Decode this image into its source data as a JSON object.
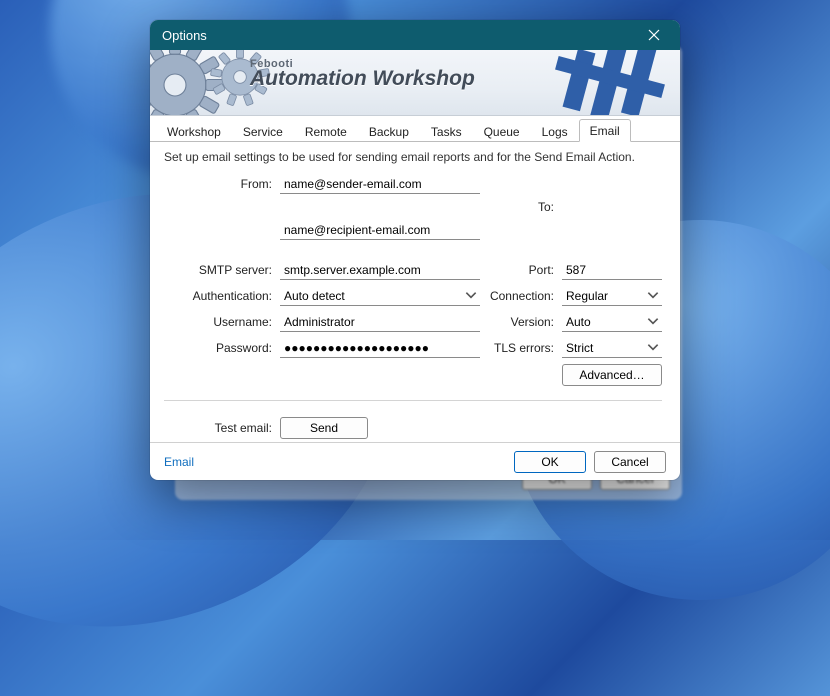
{
  "window": {
    "title": "Options"
  },
  "banner": {
    "brand_small": "Febooti",
    "brand_main": "Automation Workshop"
  },
  "tabs": {
    "items": [
      "Workshop",
      "Service",
      "Remote",
      "Backup",
      "Tasks",
      "Queue",
      "Logs",
      "Email"
    ],
    "active_index": 7
  },
  "page": {
    "description": "Set up email settings to be used for sending email reports and for the Send Email Action."
  },
  "labels": {
    "from": "From:",
    "to": "To:",
    "smtp": "SMTP server:",
    "auth": "Authentication:",
    "user": "Username:",
    "pass": "Password:",
    "port": "Port:",
    "connection": "Connection:",
    "version": "Version:",
    "tls": "TLS errors:",
    "test": "Test email:"
  },
  "values": {
    "from": "name@sender-email.com",
    "to": "name@recipient-email.com",
    "smtp": "smtp.server.example.com",
    "auth": "Auto detect",
    "user": "Administrator",
    "pass": "●●●●●●●●●●●●●●●●●●●●",
    "port": "587",
    "connection": "Regular",
    "version": "Auto",
    "tls": "Strict"
  },
  "buttons": {
    "advanced": "Advanced…",
    "send": "Send",
    "ok": "OK",
    "cancel": "Cancel"
  },
  "footer": {
    "help_link": "Email"
  },
  "ghost": {
    "ok": "OK",
    "cancel": "Cancel"
  }
}
